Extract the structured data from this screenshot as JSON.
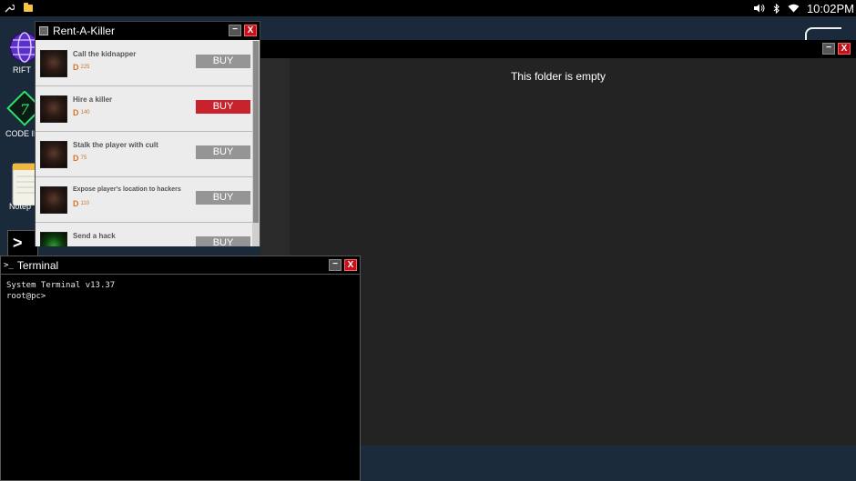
{
  "topbar": {
    "time": "10:02PM",
    "icons": [
      "wrench-icon",
      "folder-icon",
      "volume-icon",
      "bluetooth-icon",
      "wifi-icon"
    ]
  },
  "desktop": {
    "icons": [
      {
        "label": "RIFT",
        "icon": "globe-icon"
      },
      {
        "label": "CODE ID",
        "icon": "code-icon"
      },
      {
        "label": "Notep",
        "icon": "notepad-icon"
      },
      {
        "label": "",
        "icon": "terminal-icon"
      }
    ]
  },
  "explorer": {
    "empty_message": "This folder is empty"
  },
  "rent_a_killer": {
    "title": "Rent-A-Killer",
    "items": [
      {
        "name": "Call the kidnapper",
        "price": "225",
        "buy": "BUY",
        "active": false
      },
      {
        "name": "Hire a killer",
        "price": "140",
        "buy": "BUY",
        "active": true
      },
      {
        "name": "Stalk the player with cult",
        "price": "75",
        "buy": "BUY",
        "active": false
      },
      {
        "name": "Expose player's location to hackers",
        "price": "110",
        "buy": "BUY",
        "active": false
      },
      {
        "name": "Send a hack",
        "price": "",
        "buy": "BUY",
        "active": false
      }
    ],
    "currency_symbol": "D"
  },
  "terminal": {
    "title": "Terminal",
    "prompt_icon": ">_",
    "lines": [
      "System Terminal v13.37",
      "root@pc>"
    ]
  },
  "window_buttons": {
    "minimize": "−",
    "close": "X"
  },
  "colors": {
    "accent_red": "#c8232c",
    "price_orange": "#d8742a",
    "desktop_bg": "#1b2a3a"
  }
}
